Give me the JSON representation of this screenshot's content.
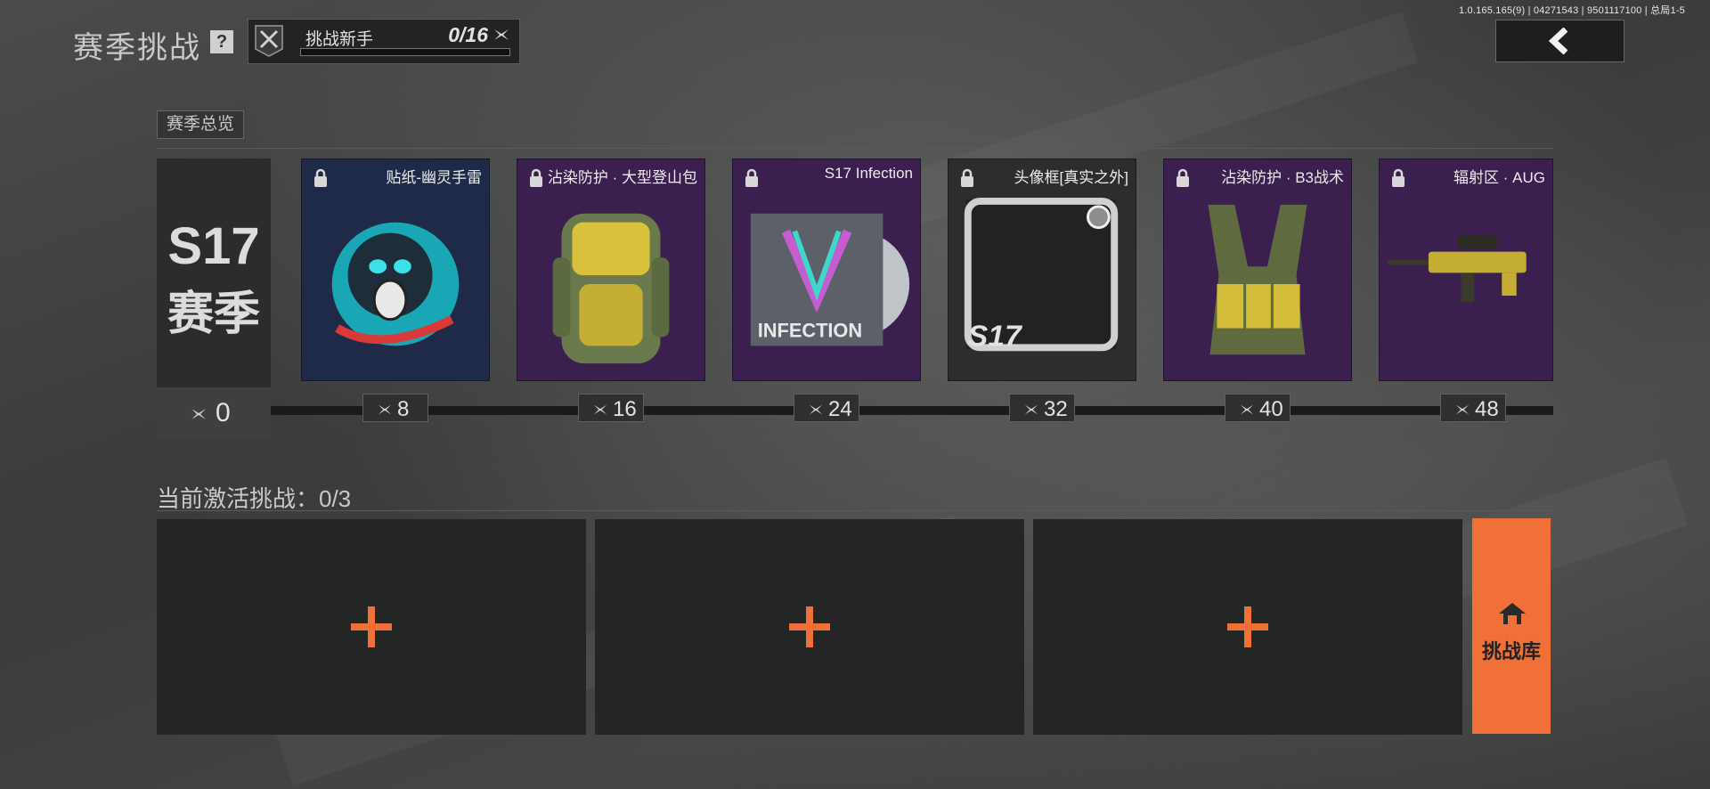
{
  "version_info": "1.0.165.165(9) | 04271543 | 9501117100 | 总局1-5",
  "header": {
    "title": "赛季挑战",
    "help_glyph": "?",
    "level": {
      "name": "挑战新手",
      "count": "0/16",
      "progress": 0,
      "icon": "crossed-blades-icon"
    },
    "back_icon": "chevron-left-icon"
  },
  "overview_tab": "赛季总览",
  "season": {
    "code": "S17",
    "name": "赛季",
    "stars": "0"
  },
  "rewards": [
    {
      "label": "贴纸-幽灵手雷",
      "stars": "8",
      "rarity_color": "#1e2a48",
      "icon": "ghost-grenade-sticker-icon"
    },
    {
      "label": "沾染防护 · 大型登山包",
      "stars": "16",
      "rarity_color": "#3b1f4e",
      "icon": "backpack-icon"
    },
    {
      "label": "S17 Infection",
      "stars": "24",
      "rarity_color": "#3b1f4e",
      "icon": "infection-card-icon"
    },
    {
      "label": "头像框[真实之外]",
      "stars": "32",
      "rarity_color": "#2c2d2d",
      "icon": "avatar-frame-icon"
    },
    {
      "label": "沾染防护 · B3战术",
      "stars": "40",
      "rarity_color": "#3b1f4e",
      "icon": "tactical-vest-icon"
    },
    {
      "label": "辐射区 · AUG",
      "stars": "48",
      "rarity_color": "#3b1f4e",
      "icon": "rifle-icon"
    }
  ],
  "active_challenges": {
    "label": "当前激活挑战：0/3",
    "slots": 3,
    "accent": "#f07038"
  },
  "library_button": {
    "label": "挑战库",
    "icon": "home-icon"
  }
}
